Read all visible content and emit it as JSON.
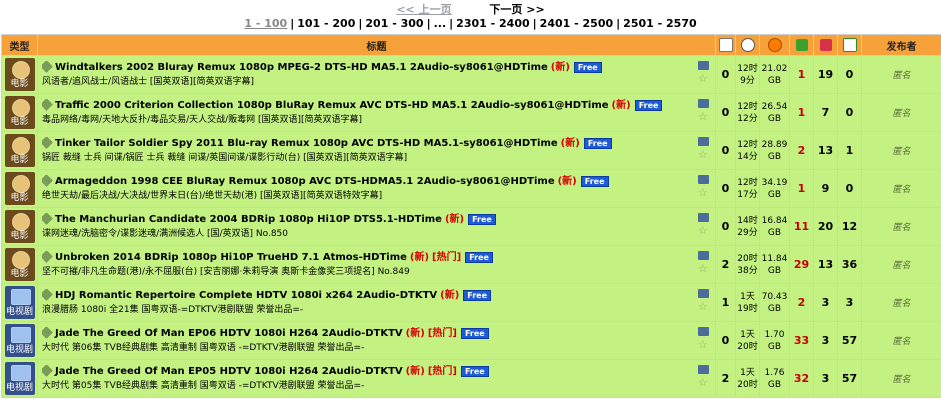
{
  "pager": {
    "prev": "<< 上一页",
    "next": "下一页 >>",
    "pages": [
      "1 - 100",
      "101 - 200",
      "201 - 300",
      "...",
      "2301 - 2400",
      "2401 - 2500",
      "2501 - 2570"
    ]
  },
  "header": {
    "type": "类型",
    "title": "标题",
    "uploader": "发布者"
  },
  "rows": [
    {
      "cat": "电影",
      "kind": "movie",
      "name": "Windtalkers 2002 Bluray Remux 1080p MPEG-2 DTS-HD MA5.1 2Audio-sy8061@HDTime",
      "new": "(新)",
      "hot": "",
      "free": "Free",
      "sub": "风语者/追风战士/风语战士 [国英双语][简英双语字幕]",
      "comments": "0",
      "time": "12时\n9分",
      "size": "21.02\nGB",
      "seeders": "1",
      "leechers": "19",
      "done": "0",
      "uploader": "匿名"
    },
    {
      "cat": "电影",
      "kind": "movie",
      "name": "Traffic 2000 Criterion Collection 1080p BluRay Remux AVC DTS-HD MA5.1 2Audio-sy8061@HDTime",
      "new": "(新)",
      "hot": "",
      "free": "Free",
      "sub": "毒品网络/毒网/天地大反扑/毒品交易/天人交战/贩毒网 [国英双语][简英双语字幕]",
      "comments": "0",
      "time": "12时\n12分",
      "size": "26.54\nGB",
      "seeders": "1",
      "leechers": "7",
      "done": "0",
      "uploader": "匿名"
    },
    {
      "cat": "电影",
      "kind": "movie",
      "name": "Tinker Tailor Soldier Spy 2011 Blu-ray Remux 1080p AVC DTS-HD MA5.1-sy8061@HDTime",
      "new": "(新)",
      "hot": "",
      "free": "Free",
      "sub": "锅匠 裁缝 士兵 间谍/锅匠 士兵 裁缝 间谍/英国间谍/谍影行动(台) [国英双语][简英双语字幕]",
      "comments": "0",
      "time": "12时\n14分",
      "size": "28.89\nGB",
      "seeders": "2",
      "leechers": "13",
      "done": "1",
      "uploader": "匿名"
    },
    {
      "cat": "电影",
      "kind": "movie",
      "name": "Armageddon 1998 CEE BluRay Remux 1080p AVC DTS-HDMA5.1 2Audio-sy8061@HDTime",
      "new": "(新)",
      "hot": "",
      "free": "Free",
      "sub": "绝世天劫/最后决战/大决战/世界末日(台)/绝世天劫(港) [国英双语][简英双语特效字幕]",
      "comments": "0",
      "time": "12时\n17分",
      "size": "34.19\nGB",
      "seeders": "1",
      "leechers": "9",
      "done": "0",
      "uploader": "匿名"
    },
    {
      "cat": "电影",
      "kind": "movie",
      "name": "The Manchurian Candidate 2004 BDRip 1080p Hi10P DTS5.1-HDTime",
      "new": "(新)",
      "hot": "",
      "free": "Free",
      "sub": "谍网迷魂/洗脑密令/谍影迷魂/满洲候选人 [国/英双语] No.850",
      "comments": "0",
      "time": "14时\n29分",
      "size": "16.84\nGB",
      "seeders": "11",
      "leechers": "20",
      "done": "12",
      "uploader": "匿名"
    },
    {
      "cat": "电影",
      "kind": "movie",
      "name": "Unbroken 2014 BDRip 1080p Hi10P TrueHD 7.1 Atmos-HDTime",
      "new": "(新)",
      "hot": "[热门]",
      "free": "Free",
      "sub": "坚不可摧/非凡生命题(港)/永不屈服(台) [安吉丽娜·朱莉导演 奥斯卡金像奖三项提名] No.849",
      "comments": "2",
      "time": "20时\n38分",
      "size": "11.84\nGB",
      "seeders": "29",
      "leechers": "13",
      "done": "36",
      "uploader": "匿名"
    },
    {
      "cat": "电视剧",
      "kind": "tv",
      "name": "HDJ Romantic Repertoire Complete HDTV 1080i x264 2Audio-DTKTV",
      "new": "(新)",
      "hot": "",
      "free": "Free",
      "sub": "浪漫腊肠 1080i 全21集 国粤双语-=DTKTV港剧联盟 荣誉出品=-",
      "comments": "1",
      "time": "1天\n19时",
      "size": "70.43\nGB",
      "seeders": "2",
      "leechers": "3",
      "done": "3",
      "uploader": "匿名"
    },
    {
      "cat": "电视剧",
      "kind": "tv",
      "name": "Jade The Greed Of Man EP06 HDTV 1080i H264 2Audio-DTKTV",
      "new": "(新)",
      "hot": "[热门]",
      "free": "Free",
      "sub": "大时代 第06集 TVB经典剧集 高清重制 国粤双语 -=DTKTV港剧联盟 荣誉出品=-",
      "comments": "0",
      "time": "1天\n20时",
      "size": "1.70\nGB",
      "seeders": "33",
      "leechers": "3",
      "done": "57",
      "uploader": "匿名"
    },
    {
      "cat": "电视剧",
      "kind": "tv",
      "name": "Jade The Greed Of Man EP05 HDTV 1080i H264 2Audio-DTKTV",
      "new": "(新)",
      "hot": "[热门]",
      "free": "Free",
      "sub": "大时代 第05集 TVB经典剧集 高清重制 国粤双语 -=DTKTV港剧联盟 荣誉出品=-",
      "comments": "2",
      "time": "1天\n20时",
      "size": "1.76\nGB",
      "seeders": "32",
      "leechers": "3",
      "done": "57",
      "uploader": "匿名"
    }
  ]
}
